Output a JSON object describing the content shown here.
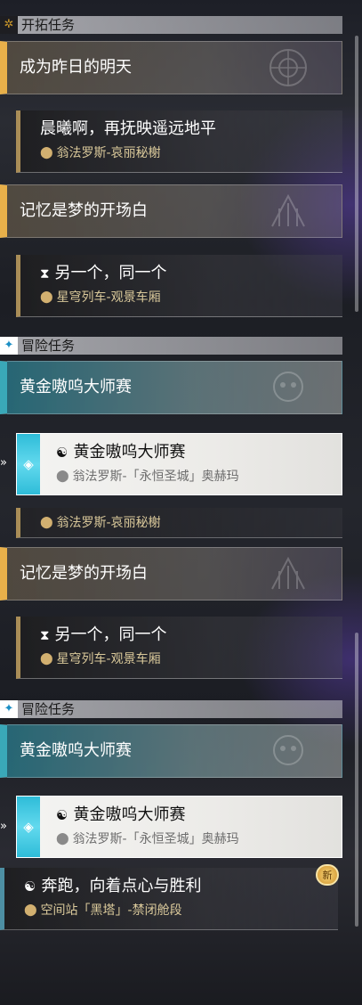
{
  "sections": {
    "trailblaze": {
      "label": "开拓任务",
      "icon": "trailblaze-star-icon"
    },
    "adventure": {
      "label": "冒险任务",
      "icon": "adventure-sparkle-icon"
    }
  },
  "groups": {
    "g1": "成为昨日的明天",
    "g2": "记忆是梦的开场白",
    "g3": "黄金嗷呜大师赛"
  },
  "quests": {
    "q1": {
      "title": "晨曦啊，再抚映遥远地平",
      "location": "翁法罗斯-哀丽秘榭"
    },
    "q2": {
      "title": "另一个，同一个",
      "location": "星穹列车-观景车厢"
    },
    "q3": {
      "title": "黄金嗷呜大师赛",
      "location": "翁法罗斯-「永恒圣城」奥赫玛"
    },
    "q4": {
      "title": "奔跑，向着点心与胜利",
      "location": "空间站「黑塔」-禁闭舱段"
    }
  },
  "badge_new": "新",
  "colors": {
    "trailblaze_accent": "#e8b04a",
    "adventure_accent": "#3aa8b8",
    "selected_strip": "#2ebcd8"
  }
}
